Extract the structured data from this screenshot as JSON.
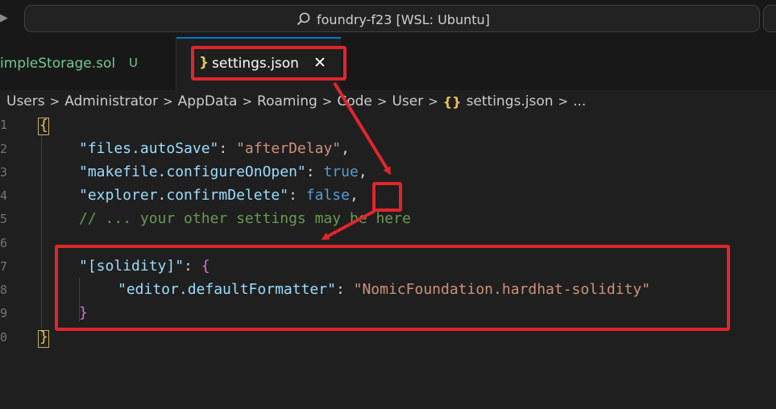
{
  "titlebar": {
    "search_text": "foundry-f23 [WSL: Ubuntu]",
    "icons": [
      "search-icon",
      "chevron-right-icon"
    ]
  },
  "tabs": [
    {
      "label": "impleStorage.sol",
      "badge": "U",
      "active": false,
      "color": "#73c991"
    },
    {
      "label": "settings.json",
      "icon": "json-braces-icon",
      "close": "✕",
      "active": true
    }
  ],
  "breadcrumb": {
    "items": [
      "Users",
      "Administrator",
      "AppData",
      "Roaming",
      "Code",
      "User",
      "settings.json",
      "..."
    ],
    "separator": ">",
    "file_icon": "{}"
  },
  "editor": {
    "line_numbers": [
      "1",
      "2",
      "3",
      "4",
      "5",
      "6",
      "7",
      "8",
      "9",
      "0"
    ],
    "tokens": {
      "l1_open": "{",
      "l2_key": "\"files.autoSave\"",
      "l2_colon": ": ",
      "l2_val": "\"afterDelay\"",
      "l2_comma": ",",
      "l3_key": "\"makefile.configureOnOpen\"",
      "l3_colon": ": ",
      "l3_val": "true",
      "l3_comma": ",",
      "l4_key": "\"explorer.confirmDelete\"",
      "l4_colon": ": ",
      "l4_val": "false",
      "l4_comma": ",",
      "l5_comment": "// ... your other settings may be here",
      "l7_key": "\"[solidity]\"",
      "l7_colon": ": ",
      "l7_open": "{",
      "l8_key": "\"editor.defaultFormatter\"",
      "l8_colon": ": ",
      "l8_val": "\"NomicFoundation.hardhat-solidity\"",
      "l9_close": "}",
      "l10_close": "}"
    }
  },
  "colors": {
    "annotation": "#e0262c",
    "key": "#9cdcfe",
    "string": "#ce9178",
    "keyword": "#569cd6",
    "comment": "#6a9955",
    "bracket_gold": "#e8c35a",
    "bracket_purple": "#da70d6"
  }
}
